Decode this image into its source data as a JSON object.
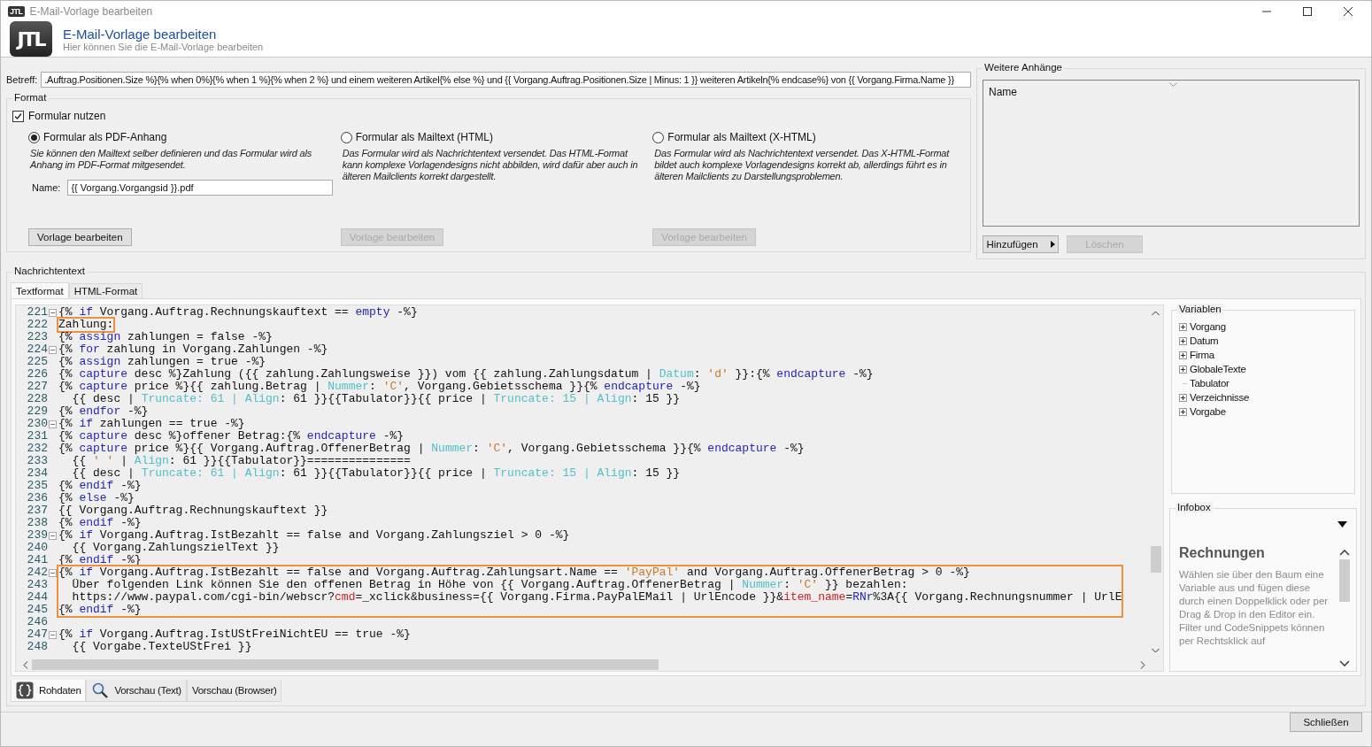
{
  "window": {
    "icon_label": "JTL",
    "title": "E-Mail-Vorlage bearbeiten"
  },
  "header": {
    "logo": "JTL",
    "title": "E-Mail-Vorlage bearbeiten",
    "subtitle": "Hier können Sie die E-Mail-Vorlage bearbeiten"
  },
  "subject": {
    "label": "Betreff:",
    "value": ".Auftrag.Positionen.Size %}{% when 0%}{% when 1 %}{% when 2 %} und einem weiteren Artikel{% else %} und {{ Vorgang.Auftrag.Positionen.Size | Minus: 1 }} weiteren Artikeln{% endcase%} von {{ Vorgang.Firma.Name }}"
  },
  "format": {
    "title": "Format",
    "use_form": {
      "label": "Formular nutzen",
      "checked": true
    },
    "options": [
      {
        "label": "Formular als PDF-Anhang",
        "selected": true,
        "description": "Sie können den Mailtext selber definieren und das Formular wird als Anhang im PDF-Format mitgesendet.",
        "name_field": {
          "label": "Name:",
          "value": "{{ Vorgang.Vorgangsid }}.pdf"
        },
        "button": {
          "label": "Vorlage bearbeiten",
          "disabled": false
        }
      },
      {
        "label": "Formular als Mailtext (HTML)",
        "selected": false,
        "description": "Das Formular wird als Nachrichtentext versendet. Das HTML-Format kann komplexe Vorlagendesigns nicht abbilden, wird dafür aber auch in älteren Mailclients korrekt dargestellt.",
        "button": {
          "label": "Vorlage bearbeiten",
          "disabled": true
        }
      },
      {
        "label": "Formular als Mailtext (X-HTML)",
        "selected": false,
        "description": "Das Formular wird als Nachrichtentext versendet. Das X-HTML-Format bildet auch komplexe Vorlagendesigns korrekt ab, allerdings führt es in älteren Mailclients zu Darstellungsproblemen.",
        "button": {
          "label": "Vorlage bearbeiten",
          "disabled": true
        }
      }
    ]
  },
  "attachments": {
    "title": "Weitere Anhänge",
    "column": "Name",
    "buttons": [
      {
        "label": "Hinzufügen",
        "disabled": false,
        "menu": true
      },
      {
        "label": "Löschen",
        "disabled": true,
        "menu": false
      }
    ]
  },
  "message": {
    "title": "Nachrichtentext",
    "tabs": [
      {
        "label": "Textformat",
        "selected": true
      },
      {
        "label": "HTML-Format",
        "selected": false
      }
    ],
    "code_blocks": [
      {
        "marked": false,
        "lines": [
          {
            "number": "221",
            "foldable": true,
            "segments": [
              {
                "kind": "plain",
                "text": "{% "
              },
              {
                "kind": "keyword",
                "text": "if"
              },
              {
                "kind": "plain",
                "text": " Vorgang.Auftrag.Rechnungskauftext == "
              },
              {
                "kind": "keyword",
                "text": "empty"
              },
              {
                "kind": "plain",
                "text": " -%}"
              }
            ]
          }
        ]
      },
      {
        "marked": true,
        "lines": [
          {
            "number": "222",
            "foldable": false,
            "segments": [
              {
                "kind": "plain",
                "text": "Zahlung:"
              }
            ]
          }
        ]
      },
      {
        "marked": false,
        "lines": [
          {
            "number": "223",
            "foldable": false,
            "segments": [
              {
                "kind": "plain",
                "text": "{% "
              },
              {
                "kind": "keyword",
                "text": "assign"
              },
              {
                "kind": "plain",
                "text": " zahlungen = false -%}"
              }
            ]
          },
          {
            "number": "224",
            "foldable": true,
            "segments": [
              {
                "kind": "plain",
                "text": "{% "
              },
              {
                "kind": "keyword",
                "text": "for"
              },
              {
                "kind": "plain",
                "text": " zahlung in Vorgang.Zahlungen -%}"
              }
            ]
          },
          {
            "number": "225",
            "foldable": false,
            "segments": [
              {
                "kind": "plain",
                "text": "{% "
              },
              {
                "kind": "keyword",
                "text": "assign"
              },
              {
                "kind": "plain",
                "text": " zahlungen = true -%}"
              }
            ]
          },
          {
            "number": "226",
            "foldable": false,
            "segments": [
              {
                "kind": "plain",
                "text": "{% "
              },
              {
                "kind": "keyword",
                "text": "capture"
              },
              {
                "kind": "plain",
                "text": " desc %}Zahlung ({{ zahlung.Zahlungsweise }}) vom {{ zahlung.Zahlungsdatum | "
              },
              {
                "kind": "filter",
                "text": "Datum"
              },
              {
                "kind": "plain",
                "text": ": "
              },
              {
                "kind": "string",
                "text": "'d'"
              },
              {
                "kind": "plain",
                "text": " }}:{% "
              },
              {
                "kind": "keyword",
                "text": "endcapture"
              },
              {
                "kind": "plain",
                "text": " -%}"
              }
            ]
          },
          {
            "number": "227",
            "foldable": false,
            "segments": [
              {
                "kind": "plain",
                "text": "{% "
              },
              {
                "kind": "keyword",
                "text": "capture"
              },
              {
                "kind": "plain",
                "text": " price %}{{ zahlung.Betrag | "
              },
              {
                "kind": "filter",
                "text": "Nummer"
              },
              {
                "kind": "plain",
                "text": ": "
              },
              {
                "kind": "string",
                "text": "'C'"
              },
              {
                "kind": "plain",
                "text": ", Vorgang.Gebietsschema }}{% "
              },
              {
                "kind": "keyword",
                "text": "endcapture"
              },
              {
                "kind": "plain",
                "text": " -%}"
              }
            ]
          },
          {
            "number": "228",
            "foldable": false,
            "segments": [
              {
                "kind": "plain",
                "text": "  {{ desc | "
              },
              {
                "kind": "filter",
                "text": "Truncate: 61 | Align"
              },
              {
                "kind": "plain",
                "text": ": 61 }}{{Tabulator}}{{ price | "
              },
              {
                "kind": "filter",
                "text": "Truncate: 15 | Align"
              },
              {
                "kind": "plain",
                "text": ": 15 }}"
              }
            ]
          },
          {
            "number": "229",
            "foldable": false,
            "segments": [
              {
                "kind": "plain",
                "text": "{% "
              },
              {
                "kind": "keyword",
                "text": "endfor"
              },
              {
                "kind": "plain",
                "text": " -%}"
              }
            ]
          },
          {
            "number": "230",
            "foldable": true,
            "segments": [
              {
                "kind": "plain",
                "text": "{% "
              },
              {
                "kind": "keyword",
                "text": "if"
              },
              {
                "kind": "plain",
                "text": " zahlungen == true -%}"
              }
            ]
          },
          {
            "number": "231",
            "foldable": false,
            "segments": [
              {
                "kind": "plain",
                "text": "{% "
              },
              {
                "kind": "keyword",
                "text": "capture"
              },
              {
                "kind": "plain",
                "text": " desc %}offener Betrag:{% "
              },
              {
                "kind": "keyword",
                "text": "endcapture"
              },
              {
                "kind": "plain",
                "text": " -%}"
              }
            ]
          },
          {
            "number": "232",
            "foldable": false,
            "segments": [
              {
                "kind": "plain",
                "text": "{% "
              },
              {
                "kind": "keyword",
                "text": "capture"
              },
              {
                "kind": "plain",
                "text": " price %}{{ Vorgang.Auftrag.OffenerBetrag | "
              },
              {
                "kind": "filter",
                "text": "Nummer"
              },
              {
                "kind": "plain",
                "text": ": "
              },
              {
                "kind": "string",
                "text": "'C'"
              },
              {
                "kind": "plain",
                "text": ", Vorgang.Gebietsschema }}{% "
              },
              {
                "kind": "keyword",
                "text": "endcapture"
              },
              {
                "kind": "plain",
                "text": " -%}"
              }
            ]
          },
          {
            "number": "233",
            "foldable": false,
            "segments": [
              {
                "kind": "plain",
                "text": "  {{ "
              },
              {
                "kind": "string",
                "text": "' '"
              },
              {
                "kind": "plain",
                "text": " | "
              },
              {
                "kind": "filter",
                "text": "Align"
              },
              {
                "kind": "plain",
                "text": ": 61 }}{{Tabulator}}==============="
              }
            ]
          },
          {
            "number": "234",
            "foldable": false,
            "segments": [
              {
                "kind": "plain",
                "text": "  {{ desc | "
              },
              {
                "kind": "filter",
                "text": "Truncate: 61 | Align"
              },
              {
                "kind": "plain",
                "text": ": 61 }}{{Tabulator}}{{ price | "
              },
              {
                "kind": "filter",
                "text": "Truncate: 15 | Align"
              },
              {
                "kind": "plain",
                "text": ": 15 }}"
              }
            ]
          },
          {
            "number": "235",
            "foldable": false,
            "segments": [
              {
                "kind": "plain",
                "text": "{% "
              },
              {
                "kind": "keyword",
                "text": "endif"
              },
              {
                "kind": "plain",
                "text": " -%}"
              }
            ]
          },
          {
            "number": "236",
            "foldable": false,
            "segments": [
              {
                "kind": "plain",
                "text": "{% "
              },
              {
                "kind": "keyword",
                "text": "else"
              },
              {
                "kind": "plain",
                "text": " -%}"
              }
            ]
          },
          {
            "number": "237",
            "foldable": false,
            "segments": [
              {
                "kind": "plain",
                "text": "{{ Vorgang.Auftrag.Rechnungskauftext }}"
              }
            ]
          },
          {
            "number": "238",
            "foldable": false,
            "segments": [
              {
                "kind": "plain",
                "text": "{% "
              },
              {
                "kind": "keyword",
                "text": "endif"
              },
              {
                "kind": "plain",
                "text": " -%}"
              }
            ]
          },
          {
            "number": "239",
            "foldable": true,
            "segments": [
              {
                "kind": "plain",
                "text": "{% "
              },
              {
                "kind": "keyword",
                "text": "if"
              },
              {
                "kind": "plain",
                "text": " Vorgang.Auftrag.IstBezahlt == false and Vorgang.Zahlungsziel > 0 -%}"
              }
            ]
          },
          {
            "number": "240",
            "foldable": false,
            "segments": [
              {
                "kind": "plain",
                "text": "  {{ Vorgang.ZahlungszielText }}"
              }
            ]
          },
          {
            "number": "241",
            "foldable": false,
            "segments": [
              {
                "kind": "plain",
                "text": "{% "
              },
              {
                "kind": "keyword",
                "text": "endif"
              },
              {
                "kind": "plain",
                "text": " -%}"
              }
            ]
          }
        ]
      },
      {
        "marked": true,
        "lines": [
          {
            "number": "242",
            "foldable": true,
            "segments": [
              {
                "kind": "plain",
                "text": "{% "
              },
              {
                "kind": "keyword",
                "text": "if"
              },
              {
                "kind": "plain",
                "text": " Vorgang.Auftrag.IstBezahlt == false and Vorgang.Auftrag.Zahlungsart.Name == "
              },
              {
                "kind": "string",
                "text": "'PayPal'"
              },
              {
                "kind": "plain",
                "text": " and Vorgang.Auftrag.OffenerBetrag > 0 -%}"
              }
            ]
          },
          {
            "number": "243",
            "foldable": false,
            "segments": [
              {
                "kind": "plain",
                "text": "  Über folgenden Link können Sie den offenen Betrag in Höhe von {{ Vorgang.Auftrag.OffenerBetrag | "
              },
              {
                "kind": "filter",
                "text": "Nummer"
              },
              {
                "kind": "plain",
                "text": ": "
              },
              {
                "kind": "string",
                "text": "'C'"
              },
              {
                "kind": "plain",
                "text": " }} bezahlen:"
              }
            ]
          },
          {
            "number": "244",
            "foldable": false,
            "segments": [
              {
                "kind": "plain",
                "text": "  https://www.paypal.com/cgi-bin/webscr?"
              },
              {
                "kind": "param",
                "text": "cmd"
              },
              {
                "kind": "plain",
                "text": "=_xclick&business={{ Vorgang.Firma.PayPalEMail | UrlEncode }}&"
              },
              {
                "kind": "param",
                "text": "item_name"
              },
              {
                "kind": "plain",
                "text": "="
              },
              {
                "kind": "ref",
                "text": "RNr"
              },
              {
                "kind": "plain",
                "text": "%3A{{ Vorgang.Rechnungsnummer | UrlE"
              }
            ]
          },
          {
            "number": "245",
            "foldable": false,
            "segments": [
              {
                "kind": "plain",
                "text": "{% "
              },
              {
                "kind": "keyword",
                "text": "endif"
              },
              {
                "kind": "plain",
                "text": " -%}"
              }
            ]
          }
        ]
      },
      {
        "marked": false,
        "lines": [
          {
            "number": "246",
            "foldable": false
          },
          {
            "number": "247",
            "foldable": true,
            "segments": [
              {
                "kind": "plain",
                "text": "{% "
              },
              {
                "kind": "keyword",
                "text": "if"
              },
              {
                "kind": "plain",
                "text": " Vorgang.Auftrag.IstUStFreiNichtEU == true -%}"
              }
            ]
          },
          {
            "number": "248",
            "foldable": false,
            "segments": [
              {
                "kind": "plain",
                "text": "  {{ Vorgabe.TexteUStFrei }}"
              }
            ]
          }
        ]
      }
    ],
    "variables": {
      "title": "Variablen",
      "items": [
        {
          "label": "Vorgang",
          "kind": "group",
          "expanded": false
        },
        {
          "label": "Datum",
          "kind": "group",
          "expanded": false
        },
        {
          "label": "Firma",
          "kind": "group",
          "expanded": false
        },
        {
          "label": "GlobaleTexte",
          "kind": "group",
          "expanded": false
        },
        {
          "label": "Tabulator",
          "kind": "leaf"
        },
        {
          "label": "Verzeichnisse",
          "kind": "group",
          "expanded": false
        },
        {
          "label": "Vorgabe",
          "kind": "group",
          "expanded": false
        }
      ]
    },
    "infobox": {
      "title": "Infobox",
      "heading": "Rechnungen",
      "text": "Wählen sie über den Baum eine Variable aus und fügen diese durch einen Doppelklick oder per Drag & Drop in den Editor ein. Filter und CodeSnippets können per Rechtsklick auf"
    },
    "view_tabs": [
      {
        "label": "Rohdaten",
        "kind": "code",
        "selected": true
      },
      {
        "label": "Vorschau (Text)",
        "kind": "search",
        "selected": false
      },
      {
        "label": "Vorschau (Browser)",
        "kind": "plain",
        "selected": false
      }
    ]
  },
  "footer": {
    "close_button": "Schließen"
  }
}
